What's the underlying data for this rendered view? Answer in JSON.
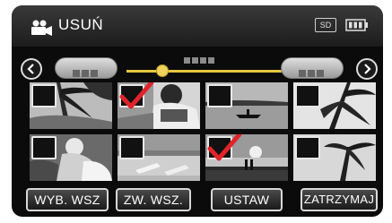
{
  "header": {
    "title": "USUŃ",
    "sd_label": "SD",
    "mode_icon": "video-camera-icon",
    "battery_icon": "battery-icon"
  },
  "navigation": {
    "prev_icon": "chevron-left-icon",
    "next_icon": "chevron-right-icon",
    "page_slider_fraction": 0.23
  },
  "thumbnails": [
    {
      "name": "thumbnail-1",
      "checked": false,
      "scene": "palm trees"
    },
    {
      "name": "thumbnail-2",
      "checked": true,
      "scene": "person reading"
    },
    {
      "name": "thumbnail-3",
      "checked": false,
      "scene": "boat on lake"
    },
    {
      "name": "thumbnail-4",
      "checked": false,
      "scene": "palm leaves"
    },
    {
      "name": "thumbnail-5",
      "checked": false,
      "scene": "people with dog"
    },
    {
      "name": "thumbnail-6",
      "checked": false,
      "scene": "beach chairs"
    },
    {
      "name": "thumbnail-7",
      "checked": true,
      "scene": "sunset beach couple"
    },
    {
      "name": "thumbnail-8",
      "checked": false,
      "scene": "palm tree"
    }
  ],
  "buttons": {
    "select_all": "WYB. WSZ",
    "release_all": "ZW. WSZ.",
    "set": "USTAW",
    "stop": "ZATRZYMAJ"
  },
  "colors": {
    "accent": "#e6c640",
    "check": "#e0242a"
  }
}
